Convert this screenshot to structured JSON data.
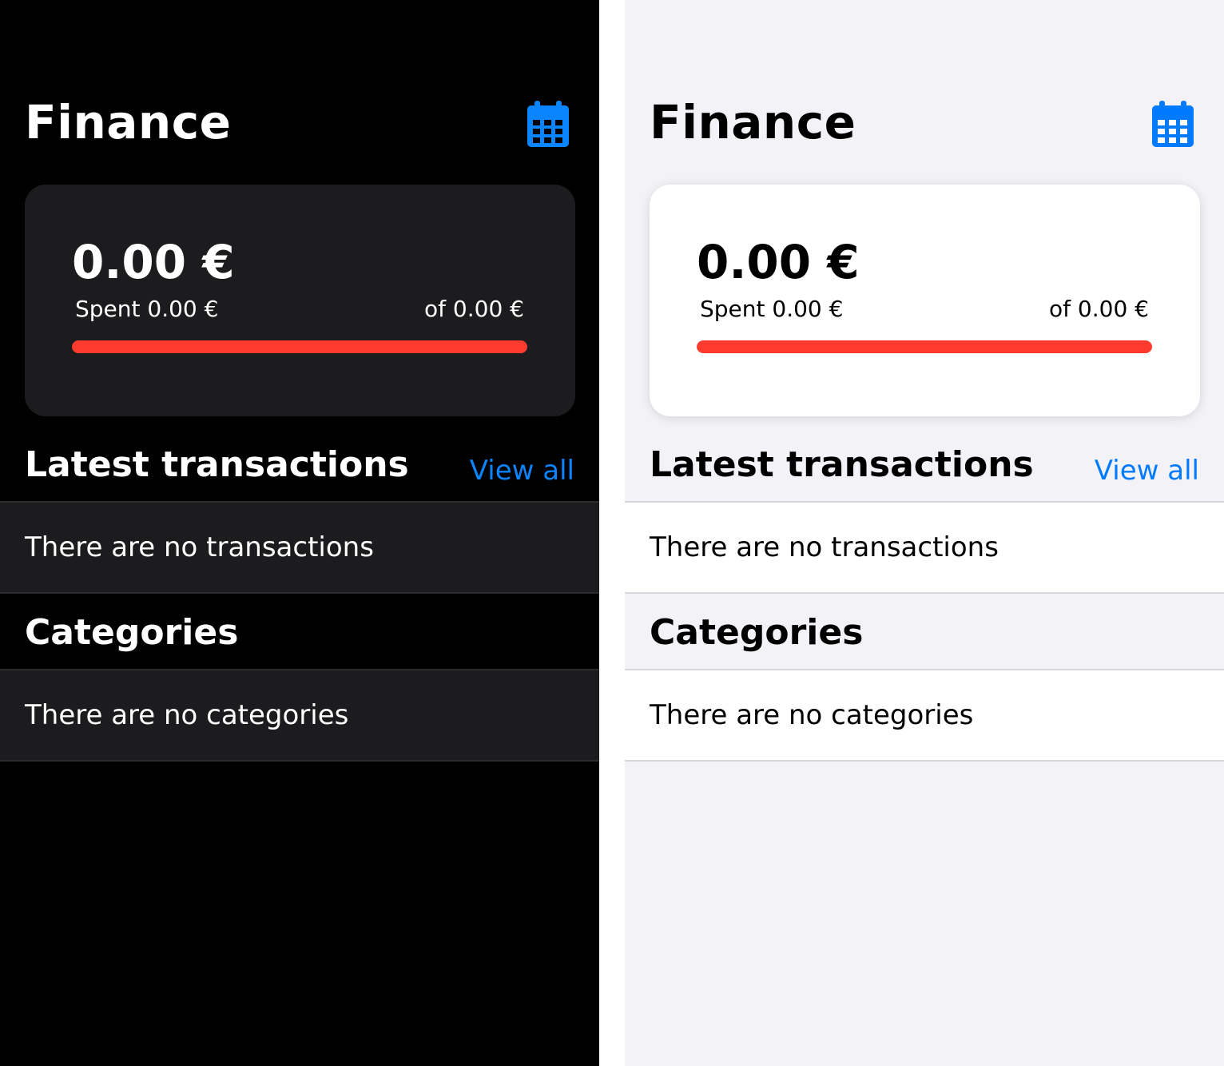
{
  "app": {
    "title": "Finance"
  },
  "calendar_icon": "calendar-icon",
  "colors": {
    "accent": "#0a84ff",
    "progress": "#ff3b30",
    "dark_background": "#000000",
    "dark_card": "#1c1c1e",
    "light_background": "#f2f2f7",
    "light_card": "#ffffff"
  },
  "budget": {
    "amount": "0.00 €",
    "spent_label": "Spent 0.00 €",
    "total_label": "of 0.00 €",
    "progress": 1.0
  },
  "transactions": {
    "title": "Latest transactions",
    "view_all": "View all",
    "empty_text": "There are no transactions"
  },
  "categories": {
    "title": "Categories",
    "empty_text": "There are no categories"
  }
}
